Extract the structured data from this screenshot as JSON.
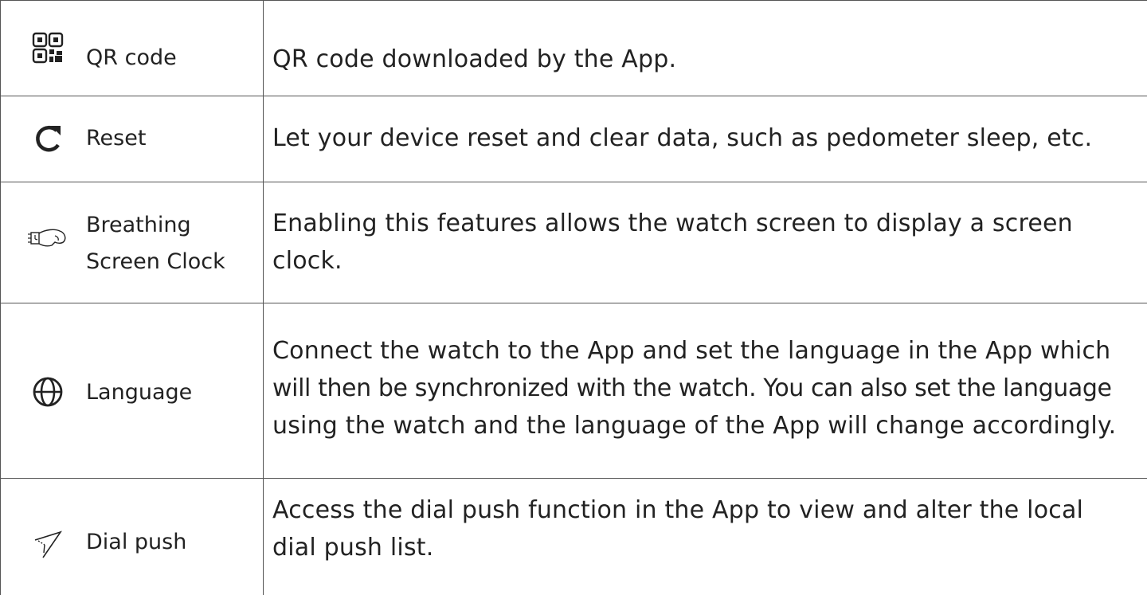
{
  "rows": [
    {
      "icon": "qr-code-icon",
      "label": "QR code",
      "description": [
        "QR code downloaded by the App."
      ]
    },
    {
      "icon": "reset-icon",
      "label": "Reset",
      "description": [
        "Let your device reset and clear data, such as pedometer sleep, etc."
      ]
    },
    {
      "icon": "wrist-watch-icon",
      "label": [
        "Breathing",
        "Screen Clock"
      ],
      "description": [
        "Enabling this features allows the watch screen to display a screen",
        "clock."
      ]
    },
    {
      "icon": "globe-icon",
      "label": "Language",
      "description": [
        "Connect the watch to the App and set the language in the App which",
        "will then be synchronized with the watch. You can also set the language",
        "using the watch and the language of the App will change accordingly."
      ]
    },
    {
      "icon": "send-arrow-icon",
      "label": "Dial push",
      "description": [
        "Access the dial push function in the App to view and alter the local",
        "dial push list."
      ]
    }
  ]
}
